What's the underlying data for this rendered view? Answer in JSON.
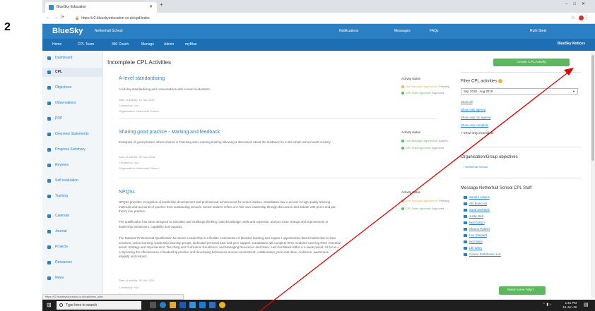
{
  "step_number": "2",
  "browser": {
    "tab_title": "BlueSky Education",
    "url": "https://v2.blueskyeducation.co.uk/cpd/index"
  },
  "app": {
    "logo": "BlueSky",
    "school": "Netherhall School",
    "top_right": {
      "notifications": "Notifications",
      "messages": "Messages",
      "faqs": "FAQs",
      "user": "Ruth Steel"
    },
    "nav": [
      "Home",
      "CPL Team",
      "360 Coach",
      "Manage",
      "Admin",
      "myBlue"
    ],
    "notices": "BlueSky Notices"
  },
  "sidebar": {
    "items": [
      {
        "label": "Dashboard"
      },
      {
        "label": "CPL"
      },
      {
        "label": "Objectives"
      },
      {
        "label": "Observations"
      },
      {
        "label": "PDP"
      },
      {
        "label": "Overview Statements"
      },
      {
        "label": "Progress Summary"
      },
      {
        "label": "Reviews"
      },
      {
        "label": "Self evaluation"
      },
      {
        "label": "Training"
      },
      {
        "label": "Calendar"
      },
      {
        "label": "Journal"
      },
      {
        "label": "Projects"
      },
      {
        "label": "Resources"
      },
      {
        "label": "News"
      }
    ]
  },
  "main": {
    "title": "Incomplete CPL Activities",
    "status_heading": "Activity status",
    "activities": [
      {
        "title": "A-level standardising",
        "description": "A full day standardising and conversations with A-level moderators.",
        "date": "Date of activity: 18 Jan 2019",
        "created_by": "Created by: You",
        "organisation": "Organisation: Netherhall School",
        "statuses": [
          {
            "label": "Line Manager Agreement:",
            "value": "Pending",
            "color": "#f0ad4e"
          },
          {
            "label": "CPL Team Approval:",
            "value": "Approved",
            "color": "#5cb85c"
          }
        ]
      },
      {
        "title": "Sharing good practice - Marking and feedback",
        "description": "Examples of good practice where shared in Teaching and Learning briefing following a discussion about the feedback fro in the whole school work scrutiny.",
        "date": "Date of activity: 28 Nov 2018",
        "created_by": "Created by: You",
        "organisation": "Organisation: Netherhall School",
        "statuses": [
          {
            "label": "Line Manager Agreement:",
            "value": "Agreed",
            "color": "#5cb85c"
          },
          {
            "label": "CPL Team Approval:",
            "value": "Approved",
            "color": "#5cb85c"
          }
        ]
      },
      {
        "title": "NPQSL",
        "description": "NPQSL provides recognition of leadership development and professional achievement for senior leaders. Candidates hav e access to high quality learning materials and accounts of practice from outstanding schools. Senior leaders reflect on t heir own leadership through discussion and debate with peers and put theory into practice.",
        "description2": "The qualification has been designed to stimulate and challenge thinking, build knowledge, skills and expertise, and pro mote change and improvement in leadership behaviours, capability and capacity.",
        "description3": "The National Professional Qualification for Senior Leadership is a flexible combination of blended learning and suppor t opportunities that includes face-to-face sessions, online learning, leadership learning groups, dedicated personal tutor and peer support. Candidates will complete three modules covering three essential areas: Strategy and Improvement, Tea ching and Curriculum Excellence, and Managing Resources and Risks, each facilitated within a 4-week period. All focus o n improving the effectiveness of leadership practice and developing behaviours around commitment, collaboration, pers onal drive, resilience, awareness, integrity and respect.",
        "date": "Date of activity: 30 Oct 2018",
        "created_by": "Created by: You",
        "organisation": "Organisation: Netherhall School",
        "statuses": [
          {
            "label": "Line Manager Agreement:",
            "value": "Pending",
            "color": "#f0ad4e"
          },
          {
            "label": "CPL Team Approval:",
            "value": "Approved",
            "color": "#5cb85c"
          }
        ]
      }
    ]
  },
  "right": {
    "create_button": "Create CPL Activity",
    "filter_title": "Filter CPL activities",
    "filter_value": "Sep 2018 - Aug 2019",
    "filter_links": [
      "Show all",
      "Show only agreed",
      "Show only not agreed",
      "Show only complete",
      "> Show only incomplete"
    ],
    "objectives_title": "Organisation/Group objectives",
    "objectives_link": "Netherhall School",
    "message_title": "Message Netherhall School CPL Staff",
    "staff": [
      "Sandra Adams",
      "Abi Bowcock",
      "Sarah Behtash",
      "Justin Bell",
      "Neil Dutton",
      "Sharon Palmer",
      "Lee Shepard",
      "Neil West",
      "Lilli Wiley",
      "Career Distribution List"
    ],
    "help_button": "Need some help?"
  },
  "status_bar_url": "https://v2.blueskyeducation.co.uk/cpd/view_activ",
  "taskbar": {
    "search": "Type here to search",
    "time": "1:41 PM",
    "date": "19-Jun-19"
  },
  "colors": {
    "brand": "#2b7fc3",
    "nav": "#1d6eb3",
    "create_button": "#5cb85c",
    "annotation_arrow": "#e00000"
  }
}
